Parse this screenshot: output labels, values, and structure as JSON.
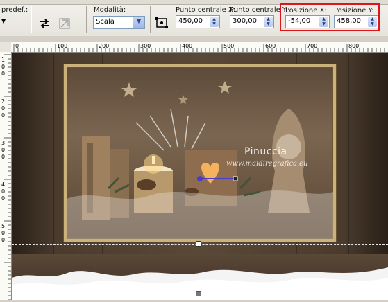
{
  "toolbar": {
    "preset_label": "predef.:",
    "mode_label": "Modalità:",
    "mode_value": "Scala",
    "center_x_label": "Punto centrale X:",
    "center_x_value": "450,00",
    "center_y_label": "Punto centrale Y:",
    "center_y_value": "300,00",
    "pos_x_label": "Posizione X:",
    "pos_x_value": "-54,00",
    "pos_y_label": "Posizione Y:",
    "pos_y_value": "458,00"
  },
  "ruler": {
    "h_ticks": [
      "0",
      "100",
      "200",
      "300",
      "400",
      "500",
      "600",
      "700",
      "800"
    ],
    "v_ticks": [
      "1",
      "0",
      "0",
      "2",
      "0",
      "0",
      "3",
      "0",
      "0",
      "4",
      "0",
      "0",
      "5",
      "0",
      "0"
    ]
  },
  "canvas": {
    "watermark_title": "Pinuccia",
    "watermark_url": "www.maidiregrafica.eu"
  },
  "icons": {
    "flip": "flip-arrow-icon",
    "reset": "reset-transform-icon",
    "pick": "pick-tool-icon"
  },
  "colors": {
    "highlight": "#e0141b",
    "frame": "#cbb17a"
  }
}
